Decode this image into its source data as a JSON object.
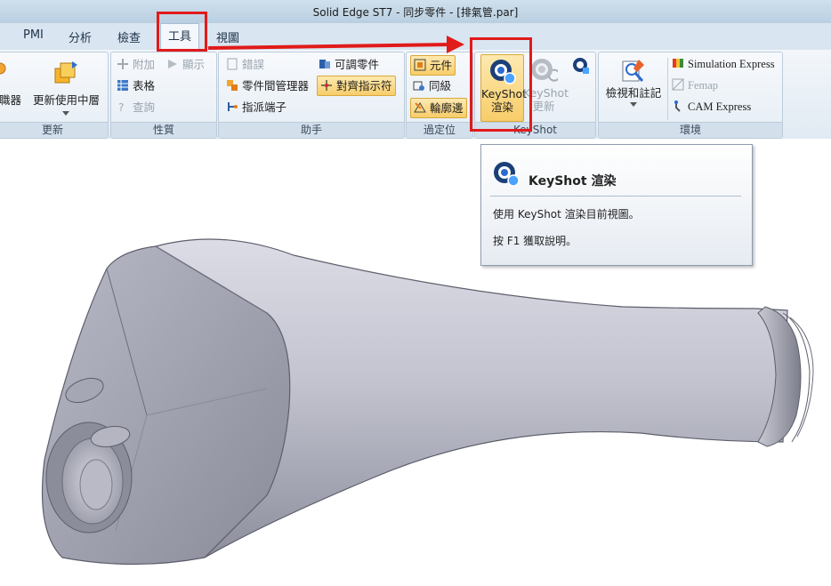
{
  "window": {
    "title": "Solid Edge ST7 - 同步零件 - [排氣管.par]"
  },
  "tabs": [
    {
      "label": "PMI"
    },
    {
      "label": "分析"
    },
    {
      "label": "檢查"
    },
    {
      "label": "工具"
    },
    {
      "label": "視圖"
    }
  ],
  "ribbon": {
    "update": {
      "label": "更新",
      "btn1": "職器",
      "btn2": "更新使用中層"
    },
    "properties": {
      "label": "性質",
      "attach": "附加",
      "display": "顯示",
      "table": "表格",
      "query": "查詢"
    },
    "assistants": {
      "label": "助手",
      "errors": "錯誤",
      "adjustable_part": "可調零件",
      "interpart_manager": "零件間管理器",
      "alignment_indicator": "對齊指示符",
      "assign_terminal": "指派端子"
    },
    "filter": {
      "label": "過定位",
      "component": "元件",
      "same_level": "同級",
      "contour_edge": "輪廓邊"
    },
    "keyshot": {
      "label": "KeyShot",
      "render_line1": "KeyShot",
      "render_line2": "渲染",
      "update_line1": "KeyShot",
      "update_line2": "更新"
    },
    "environment": {
      "label": "環境",
      "inspect_annotate": "檢視和註記",
      "simulation_express": "Simulation Express",
      "femap": "Femap",
      "cam_express": "CAM Express"
    }
  },
  "tooltip": {
    "title": "KeyShot 渲染",
    "description": "使用 KeyShot 渲染目前視圖。",
    "help": "按 F1 獲取說明。"
  },
  "colors": {
    "annotation_red": "#e11a1a",
    "ribbon_bg": "#e6eef6",
    "highlight": "#f8cd6a"
  }
}
